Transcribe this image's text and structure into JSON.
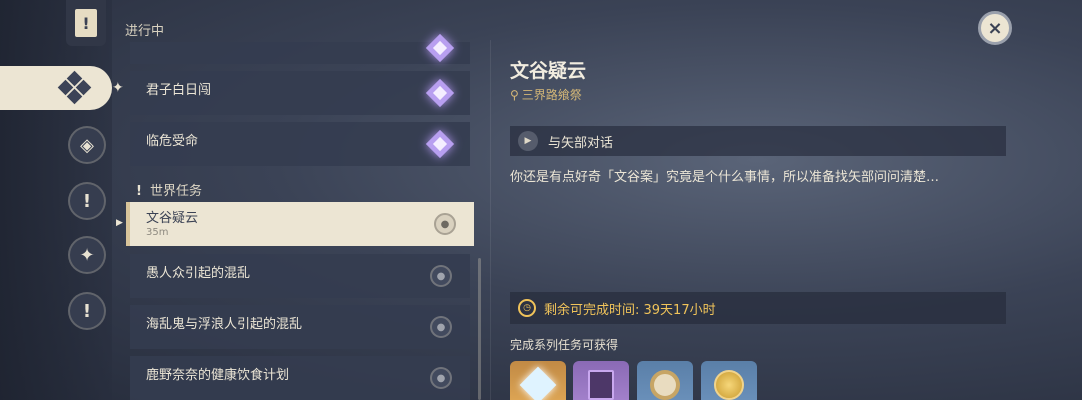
{
  "header": {
    "section_title": "进行中",
    "close_icon": "×"
  },
  "rail": {
    "items": [
      {
        "name": "quest-tab-all",
        "glyph": "!"
      },
      {
        "name": "quest-tab-archon",
        "glyph": "◆"
      },
      {
        "name": "quest-tab-story",
        "glyph": "◈"
      },
      {
        "name": "quest-tab-world",
        "glyph": "!"
      },
      {
        "name": "quest-tab-commission",
        "glyph": "✦"
      },
      {
        "name": "quest-tab-event",
        "glyph": "!"
      }
    ]
  },
  "quests": {
    "archon": [
      {
        "title": "君子白日闯"
      },
      {
        "title": "临危受命"
      }
    ],
    "world_header": "世界任务",
    "world_excl": "!",
    "world": [
      {
        "title": "文谷疑云",
        "distance": "35m",
        "active": true
      },
      {
        "title": "愚人众引起的混乱"
      },
      {
        "title": "海乱鬼与浮浪人引起的混乱"
      },
      {
        "title": "鹿野奈奈的健康饮食计划"
      }
    ]
  },
  "detail": {
    "title": "文谷疑云",
    "location": "三界路飨祭",
    "step": "与矢部对话",
    "description": "你还是有点好奇「文谷案」究竟是个什么事情，所以准备找矢部问问清楚…",
    "timer": "剩余可完成时间: 39天17小时",
    "rewards_label": "完成系列任务可获得",
    "rewards": [
      {
        "name": "primogem-icon"
      },
      {
        "name": "hero-wit-icon"
      },
      {
        "name": "mystic-enhancement-ore-icon"
      },
      {
        "name": "mora-icon"
      }
    ]
  },
  "colors": {
    "accent_gold": "#f0c35a",
    "card_active": "#ece5d3",
    "archon_purple": "#b89ff0"
  }
}
